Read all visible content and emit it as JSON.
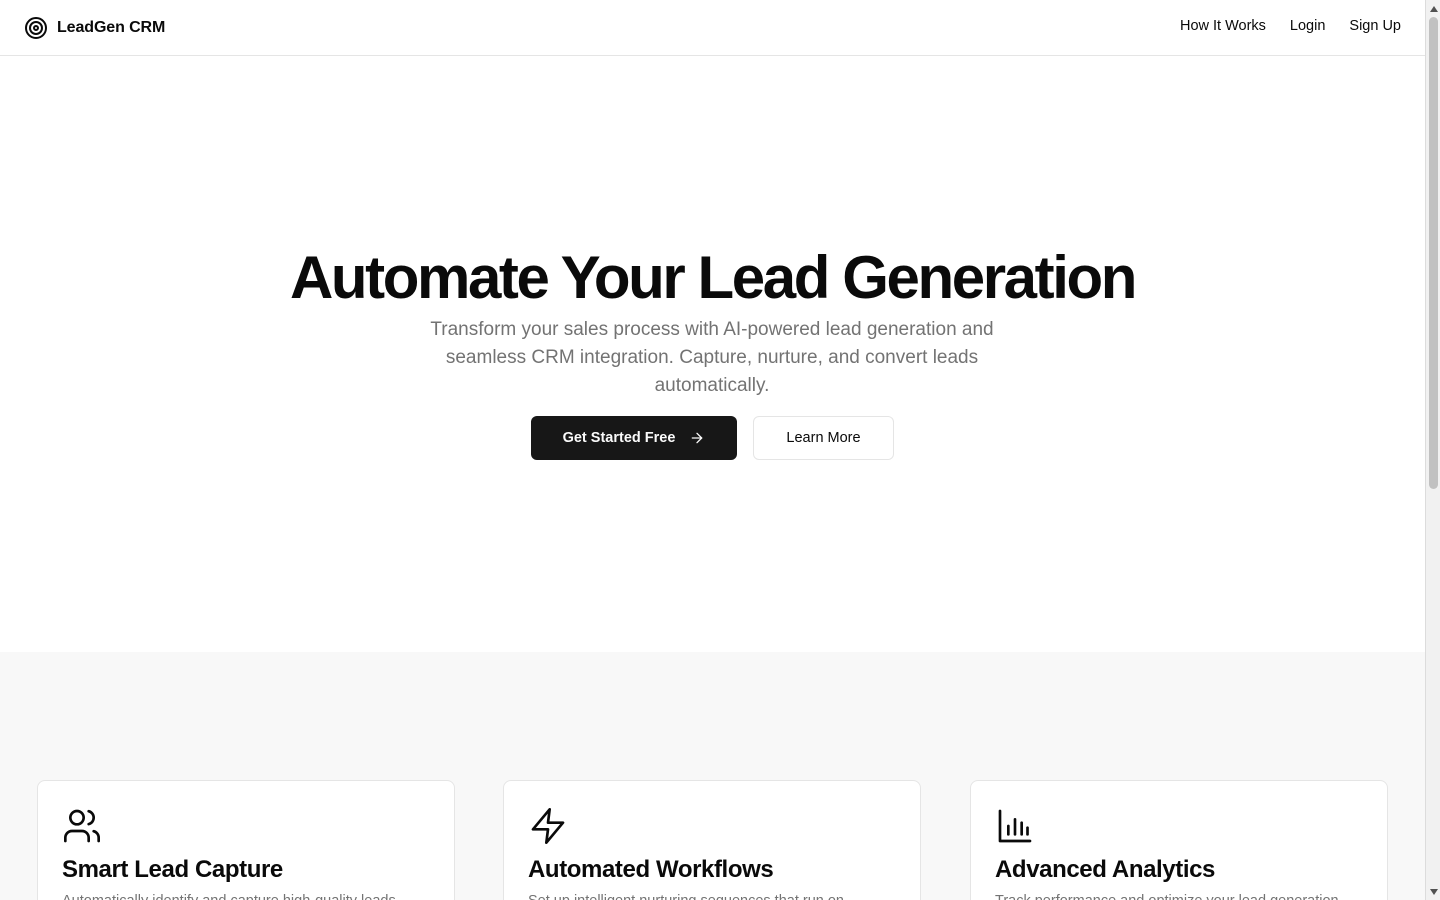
{
  "header": {
    "brand_name": "LeadGen CRM",
    "brand_icon": "target-icon",
    "nav": [
      {
        "label": "How It Works"
      },
      {
        "label": "Login"
      },
      {
        "label": "Sign Up"
      }
    ]
  },
  "hero": {
    "title": "Automate Your Lead Generation",
    "subtitle": "Transform your sales process with AI-powered lead generation and seamless CRM integration. Capture, nurture, and convert leads automatically.",
    "primary_cta": "Get Started Free",
    "primary_cta_icon": "arrow-right-icon",
    "secondary_cta": "Learn More"
  },
  "features": [
    {
      "icon": "users-icon",
      "title": "Smart Lead Capture",
      "description": "Automatically identify and capture high-quality leads"
    },
    {
      "icon": "zap-icon",
      "title": "Automated Workflows",
      "description": "Set up intelligent nurturing sequences that run on"
    },
    {
      "icon": "bar-chart-icon",
      "title": "Advanced Analytics",
      "description": "Track performance and optimize your lead generation"
    }
  ],
  "colors": {
    "primary": "#171717",
    "text": "#0a0a0a",
    "muted": "#737373",
    "border": "#e5e5e5",
    "section_bg": "#f8f8f8"
  }
}
